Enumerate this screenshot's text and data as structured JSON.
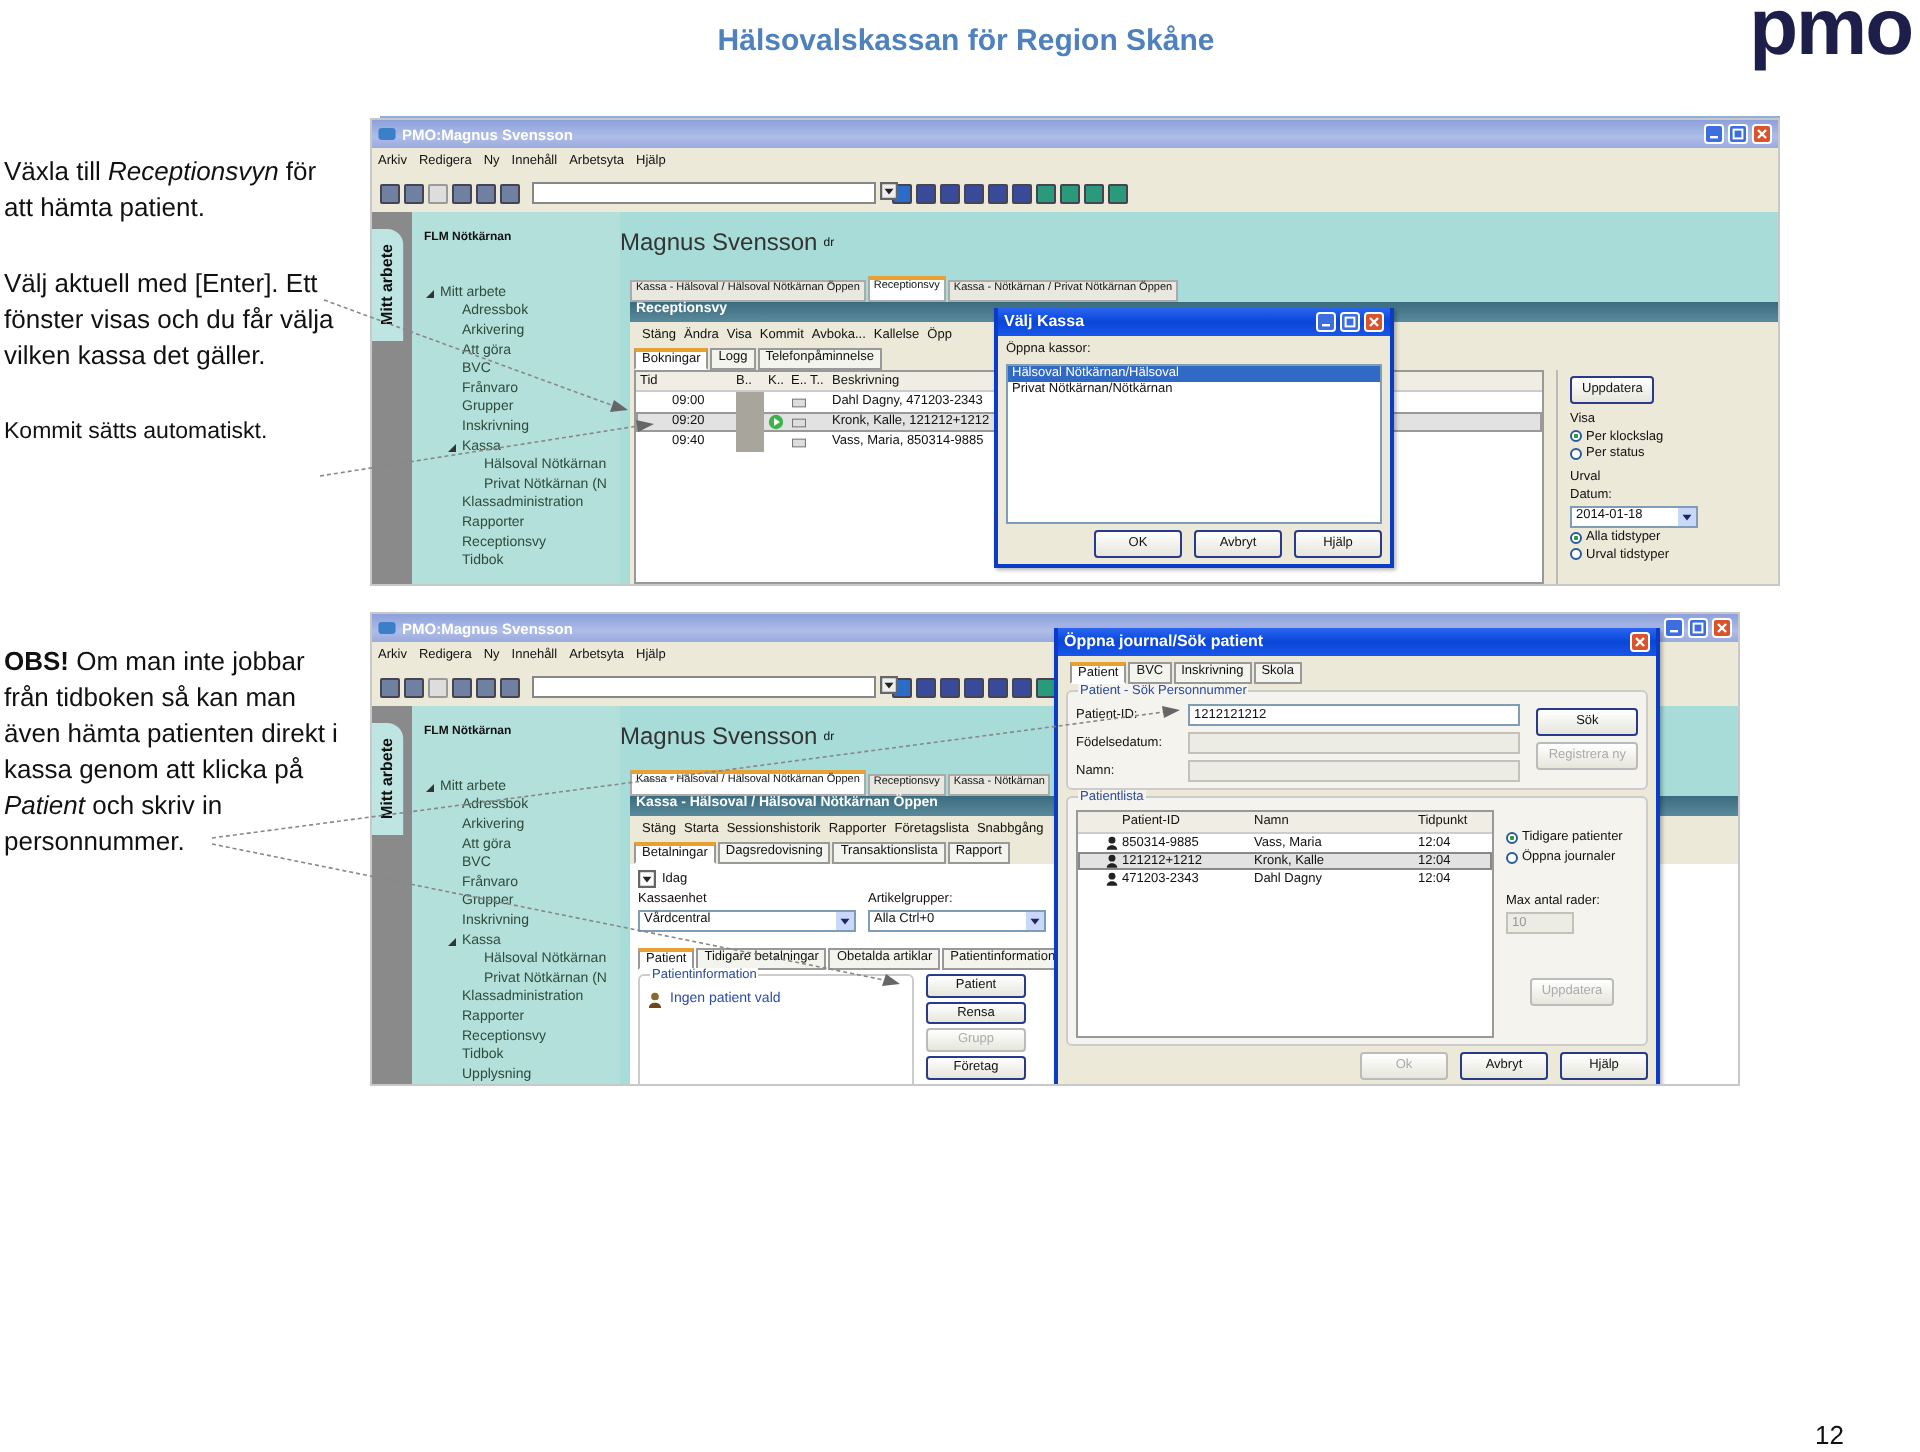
{
  "header": {
    "title": "Hälsovalskassan för Region Skåne",
    "logo": "pmo"
  },
  "notes": [
    "Växla till *Receptionsvyn* för att hämta patient.",
    "Välj aktuell med [Enter]. Ett fönster visas och du får välja vilken kassa det gäller.",
    "Kommit sätts automatiskt."
  ],
  "note_2": "**OBS!** Om man inte jobbar från tidboken så kan man även hämta patienten direkt i kassa genom att klicka på *Patient* och skriv in personnummer.",
  "screens": [
    {
      "window_title": "PMO:Magnus Svensson",
      "menu": [
        "Arkiv",
        "Redigera",
        "Ny",
        "Innehåll",
        "Arbetsyta",
        "Hjälp"
      ],
      "side_tab": "Mitt arbete",
      "unit": "FLM Nötkärnan",
      "user": "Magnus Svensson",
      "user_suffix": "dr",
      "tree": [
        {
          "label": "Mitt arbete",
          "expanded": true,
          "children": [
            {
              "label": "Adressbok"
            },
            {
              "label": "Arkivering"
            },
            {
              "label": "Att göra"
            },
            {
              "label": "BVC"
            },
            {
              "label": "Frånvaro"
            },
            {
              "label": "Grupper"
            },
            {
              "label": "Inskrivning"
            },
            {
              "label": "Kassa",
              "expanded": true,
              "children": [
                {
                  "label": "Hälsoval Nötkärnan"
                },
                {
                  "label": "Privat Nötkärnan (N"
                }
              ]
            },
            {
              "label": "Klassadministration"
            },
            {
              "label": "Rapporter"
            },
            {
              "label": "Receptionsvy"
            },
            {
              "label": "Tidbok"
            }
          ]
        }
      ],
      "doc_tabs": [
        {
          "label": "Kassa - Hälsoval / Hälsoval Nötkärnan Öppen",
          "selected": false
        },
        {
          "label": "Receptionsvy",
          "selected": true
        },
        {
          "label": "Kassa - Nötkärnan / Privat Nötkärnan Öppen",
          "selected": false
        }
      ],
      "panel": {
        "kind": "reception",
        "title": "Receptionsvy",
        "actions": [
          "Stäng",
          "Ändra",
          "Visa",
          "Kommit",
          "Avboka...",
          "Kallelse",
          "Öpp"
        ],
        "tabs": [
          {
            "label": "Bokningar",
            "selected": true
          },
          {
            "label": "Logg",
            "selected": false
          },
          {
            "label": "Telefonpåminnelse",
            "selected": false
          }
        ],
        "columns": [
          "Tid",
          "B..",
          "K..",
          "E..",
          "T..",
          "Beskrivning"
        ],
        "rows": [
          {
            "time": "09:00",
            "kommit": false,
            "description": "Dahl Dagny,  471203-2343",
            "selected": false
          },
          {
            "time": "09:20",
            "kommit": true,
            "description": "Kronk, Kalle,  121212+1212",
            "selected": true
          },
          {
            "time": "09:40",
            "kommit": false,
            "description": "Vass, Maria,  850314-9885",
            "selected": false
          }
        ],
        "side": {
          "button": "Uppdatera",
          "view_label": "Visa",
          "view_options": [
            {
              "label": "Per klockslag",
              "selected": true
            },
            {
              "label": "Per status",
              "selected": false
            }
          ],
          "filter_label": "Urval",
          "date_label": "Datum:",
          "date": "2014-01-18",
          "type_options": [
            {
              "label": "Alla tidstyper",
              "selected": true
            },
            {
              "label": "Urval tidstyper",
              "selected": false
            }
          ]
        }
      },
      "dialog": {
        "kind": "choose",
        "title": "Välj Kassa",
        "list_label": "Öppna kassor:",
        "items": [
          {
            "label": "Hälsoval Nötkärnan/Hälsoval",
            "selected": true
          },
          {
            "label": "Privat Nötkärnan/Nötkärnan",
            "selected": false
          }
        ],
        "buttons": [
          {
            "label": "OK",
            "disabled": false
          },
          {
            "label": "Avbryt",
            "disabled": false
          },
          {
            "label": "Hjälp",
            "disabled": false
          }
        ]
      }
    },
    {
      "window_title": "PMO:Magnus Svensson",
      "menu": [
        "Arkiv",
        "Redigera",
        "Ny",
        "Innehåll",
        "Arbetsyta",
        "Hjälp"
      ],
      "side_tab": "Mitt arbete",
      "unit": "FLM Nötkärnan",
      "user": "Magnus Svensson",
      "user_suffix": "dr",
      "tree": [
        {
          "label": "Mitt arbete",
          "expanded": true,
          "children": [
            {
              "label": "Adressbok"
            },
            {
              "label": "Arkivering"
            },
            {
              "label": "Att göra"
            },
            {
              "label": "BVC"
            },
            {
              "label": "Frånvaro"
            },
            {
              "label": "Grupper"
            },
            {
              "label": "Inskrivning"
            },
            {
              "label": "Kassa",
              "expanded": true,
              "children": [
                {
                  "label": "Hälsoval Nötkärnan"
                },
                {
                  "label": "Privat Nötkärnan (N"
                }
              ]
            },
            {
              "label": "Klassadministration"
            },
            {
              "label": "Rapporter"
            },
            {
              "label": "Receptionsvy"
            },
            {
              "label": "Tidbok"
            },
            {
              "label": "Upplysning"
            }
          ]
        }
      ],
      "doc_tabs": [
        {
          "label": "Kassa - Hälsoval / Hälsoval Nötkärnan Öppen",
          "selected": true
        },
        {
          "label": "Receptionsvy",
          "selected": false
        },
        {
          "label": "Kassa - Nötkärnan",
          "selected": false
        }
      ],
      "panel": {
        "kind": "register",
        "title": "Kassa - Hälsoval / Hälsoval Nötkärnan Öppen",
        "actions": [
          "Stäng",
          "Starta",
          "Sessionshistorik",
          "Rapporter",
          "Företagslista",
          "Snabbgång"
        ],
        "tabs": [
          {
            "label": "Betalningar",
            "selected": true
          },
          {
            "label": "Dagsredovisning",
            "selected": false
          },
          {
            "label": "Transaktionslista",
            "selected": false
          },
          {
            "label": "Rapport",
            "selected": false
          }
        ],
        "period": "Idag",
        "unit_label": "Kassaenhet",
        "unit": "Vårdcentral",
        "group_label": "Artikelgrupper:",
        "group": "Alla Ctrl+0",
        "patient_tabs": [
          {
            "label": "Patient",
            "selected": true
          },
          {
            "label": "Tidigare betalningar",
            "selected": false
          },
          {
            "label": "Obetalda artiklar",
            "selected": false
          },
          {
            "label": "Patientinformation",
            "selected": false
          }
        ],
        "info_legend": "Patientinformation",
        "info_text": "Ingen patient vald",
        "buttons": [
          {
            "label": "Patient",
            "disabled": false
          },
          {
            "label": "Rensa",
            "disabled": false
          },
          {
            "label": "Grupp",
            "disabled": true
          },
          {
            "label": "Företag",
            "disabled": false
          }
        ]
      },
      "dialog": {
        "kind": "search",
        "title": "Öppna journal/Sök patient",
        "tabs": [
          {
            "label": "Patient",
            "selected": true
          },
          {
            "label": "BVC",
            "selected": false
          },
          {
            "label": "Inskrivning",
            "selected": false
          },
          {
            "label": "Skola",
            "selected": false
          }
        ],
        "search_legend": "Patient - Sök Personnummer",
        "fields": [
          {
            "label": "Patient-ID:",
            "value": "1212121212",
            "disabled": false
          },
          {
            "label": "Födelsedatum:",
            "disabled": true
          },
          {
            "label": "Namn:",
            "disabled": true
          }
        ],
        "search_buttons": [
          {
            "label": "Sök",
            "disabled": false
          },
          {
            "label": "Registrera ny",
            "disabled": true
          }
        ],
        "list_legend": "Patientlista",
        "columns": [
          "Patient-ID",
          "Namn",
          "Tidpunkt"
        ],
        "rows": [
          {
            "patient_id": "850314-9885",
            "name": "Vass, Maria",
            "time": "12:04",
            "selected": false
          },
          {
            "patient_id": "121212+1212",
            "name": "Kronk, Kalle",
            "time": "12:04",
            "selected": true
          },
          {
            "patient_id": "471203-2343",
            "name": "Dahl Dagny",
            "time": "12:04",
            "selected": false
          }
        ],
        "options": [
          {
            "label": "Tidigare patienter",
            "selected": true
          },
          {
            "label": "Öppna journaler",
            "selected": false
          }
        ],
        "max_label": "Max antal rader:",
        "max_value": "10",
        "update": {
          "label": "Uppdatera",
          "disabled": true
        },
        "buttons": [
          {
            "label": "Ok",
            "disabled": true
          },
          {
            "label": "Avbryt",
            "disabled": false
          },
          {
            "label": "Hjälp",
            "disabled": false
          }
        ]
      }
    }
  ],
  "page_number": "12"
}
